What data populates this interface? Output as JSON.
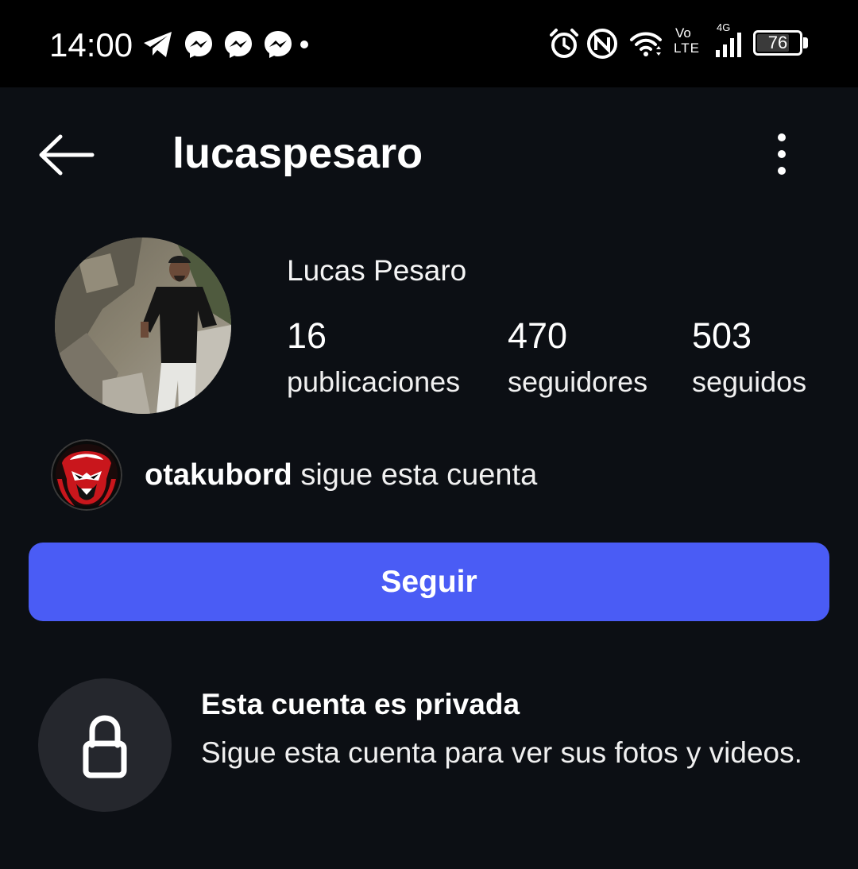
{
  "status_bar": {
    "time": "14:00",
    "network_top": "4G",
    "volte_top": "Vo",
    "volte_bottom": "LTE",
    "battery": "76",
    "notification_icons": [
      "telegram-icon",
      "messenger-icon",
      "messenger-icon",
      "messenger-icon",
      "more-notifications-dot"
    ],
    "system_icons": [
      "alarm-icon",
      "nfc-icon",
      "wifi-icon",
      "volte-icon",
      "signal-icon",
      "battery-icon"
    ]
  },
  "header": {
    "username": "lucaspesaro"
  },
  "profile": {
    "display_name": "Lucas Pesaro",
    "stats": {
      "posts_count": "16",
      "posts_label": "publicaciones",
      "followers_count": "470",
      "followers_label": "seguidores",
      "following_count": "503",
      "following_label": "seguidos"
    }
  },
  "mutual": {
    "username": "otakubord",
    "text": " sigue esta cuenta"
  },
  "actions": {
    "follow_label": "Seguir"
  },
  "private_notice": {
    "title": "Esta cuenta es privada",
    "description": "Sigue esta cuenta para ver sus fotos y videos."
  },
  "colors": {
    "background": "#0c0f14",
    "status_bar": "#000000",
    "accent_button": "#4a5cf5",
    "lock_circle": "#25272d"
  }
}
